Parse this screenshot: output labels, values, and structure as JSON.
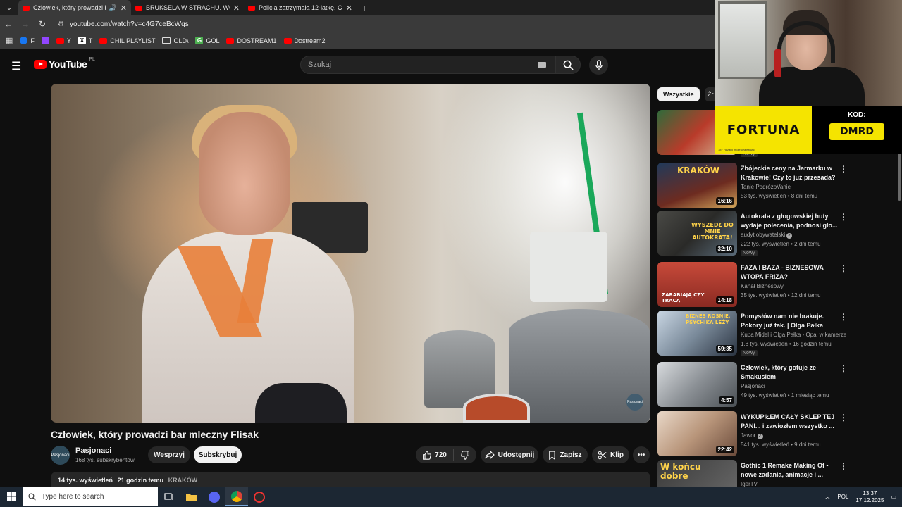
{
  "browser": {
    "tabs": [
      {
        "title": "Człowiek, który prowadzi ba",
        "active": true,
        "audio": true
      },
      {
        "title": "BRUKSELA W STRACHU. WOJN",
        "active": false
      },
      {
        "title": "Policja zatrzymała 12-latkę. Co",
        "active": false
      }
    ],
    "url": "youtube.com/watch?v=c4G7ceBcWqs",
    "bookmarks": [
      {
        "label": "F",
        "icon": "facebook-icon"
      },
      {
        "label": "",
        "icon": "twitch-icon"
      },
      {
        "label": "Y",
        "icon": "youtube-icon"
      },
      {
        "label": "T",
        "icon": "x-icon"
      },
      {
        "label": "CHIL PLAYLIST",
        "icon": "youtube-icon"
      },
      {
        "label": "OLD\\",
        "icon": "folder-icon"
      },
      {
        "label": "GOL",
        "icon": "gol-icon"
      },
      {
        "label": "DOSTREAM1",
        "icon": "youtube-icon"
      },
      {
        "label": "Dostream2",
        "icon": "youtube-icon"
      }
    ]
  },
  "youtube": {
    "logo_text": "YouTube",
    "country": "PL",
    "search_placeholder": "Szukaj"
  },
  "video": {
    "title": "Człowiek, który prowadzi bar mleczny Flisak",
    "watermark": "Pasjonaci",
    "channel": {
      "name": "Pasjonaci",
      "avatar_text": "Pasjonaci",
      "subscribers": "168 tys. subskrybentów"
    },
    "support_label": "Wesprzyj",
    "subscribe_label": "Subskrybuj",
    "likes": "720",
    "share_label": "Udostępnij",
    "save_label": "Zapisz",
    "clip_label": "Klip",
    "views": "14 tys. wyświetleń",
    "posted": "21 godzin temu",
    "hashtag": "KRAKÓW"
  },
  "sidebar": {
    "chips": [
      "Wszystkie",
      "Źr"
    ],
    "partial_badge": "Nowy",
    "items": [
      {
        "title": "Zbójeckie ceny na Jarmarku w Krakowie! Czy to już przesada?",
        "channel": "Tanie PodróżoVanie",
        "meta": "53 tys. wyświetleń • 8 dni temu",
        "duration": "16:16",
        "verified": false,
        "badge": ""
      },
      {
        "title": "Autokrata z głogowskiej huty wydaje polecenia, podnosi gło...",
        "channel": "audyt obywatelski",
        "meta": "222 tys. wyświetleń • 2 dni temu",
        "duration": "32:10",
        "verified": true,
        "badge": "Nowy"
      },
      {
        "title": "FAZA I BAZA - BIZNESOWA WTOPA FRIZA?",
        "channel": "Kanał Biznesowy",
        "meta": "35 tys. wyświetleń • 12 dni temu",
        "duration": "14:18",
        "verified": false,
        "badge": ""
      },
      {
        "title": "Pomysłów nam nie brakuje. Pokory już tak. | Olga Pałka",
        "channel": "Kuba Midel i Olga Pałka - Opal w kamerze",
        "meta": "1,8 tys. wyświetleń • 16 godzin temu",
        "duration": "59:35",
        "verified": false,
        "badge": "Nowy"
      },
      {
        "title": "Człowiek, który gotuje ze Smakusiem",
        "channel": "Pasjonaci",
        "meta": "49 tys. wyświetleń • 1 miesiąc temu",
        "duration": "4:57",
        "verified": false,
        "badge": ""
      },
      {
        "title": "WYKUPIŁEM CAŁY SKLEP TEJ PANI... i zawiozłem wszystko ...",
        "channel": "Jawor",
        "meta": "541 tys. wyświetleń • 9 dni temu",
        "duration": "22:42",
        "verified": true,
        "badge": ""
      },
      {
        "title": "Gothic 1 Remake Making Of - nowe zadania, animacje i ...",
        "channel": "IgerTV",
        "meta": "",
        "duration": "",
        "verified": false,
        "badge": ""
      }
    ],
    "thumb_texts": [
      "KRAKÓW",
      "WYSZEDŁ DO MNIE AUTOKRATA!",
      "ZARABIAJĄ CZY TRACĄ",
      "BIZNES ROŚNIE, PSYCHIKA LEŻY",
      "",
      "",
      "W końcu dobre"
    ]
  },
  "overlay": {
    "ad_brand": "FORTUNA",
    "ad_fine_print": "18+ Hazard może uzależniać",
    "code_label": "KOD:",
    "code_value": "DMRD"
  },
  "taskbar": {
    "search_placeholder": "Type here to search",
    "language": "POL",
    "time": "13:37",
    "date": "17.12.2025"
  }
}
